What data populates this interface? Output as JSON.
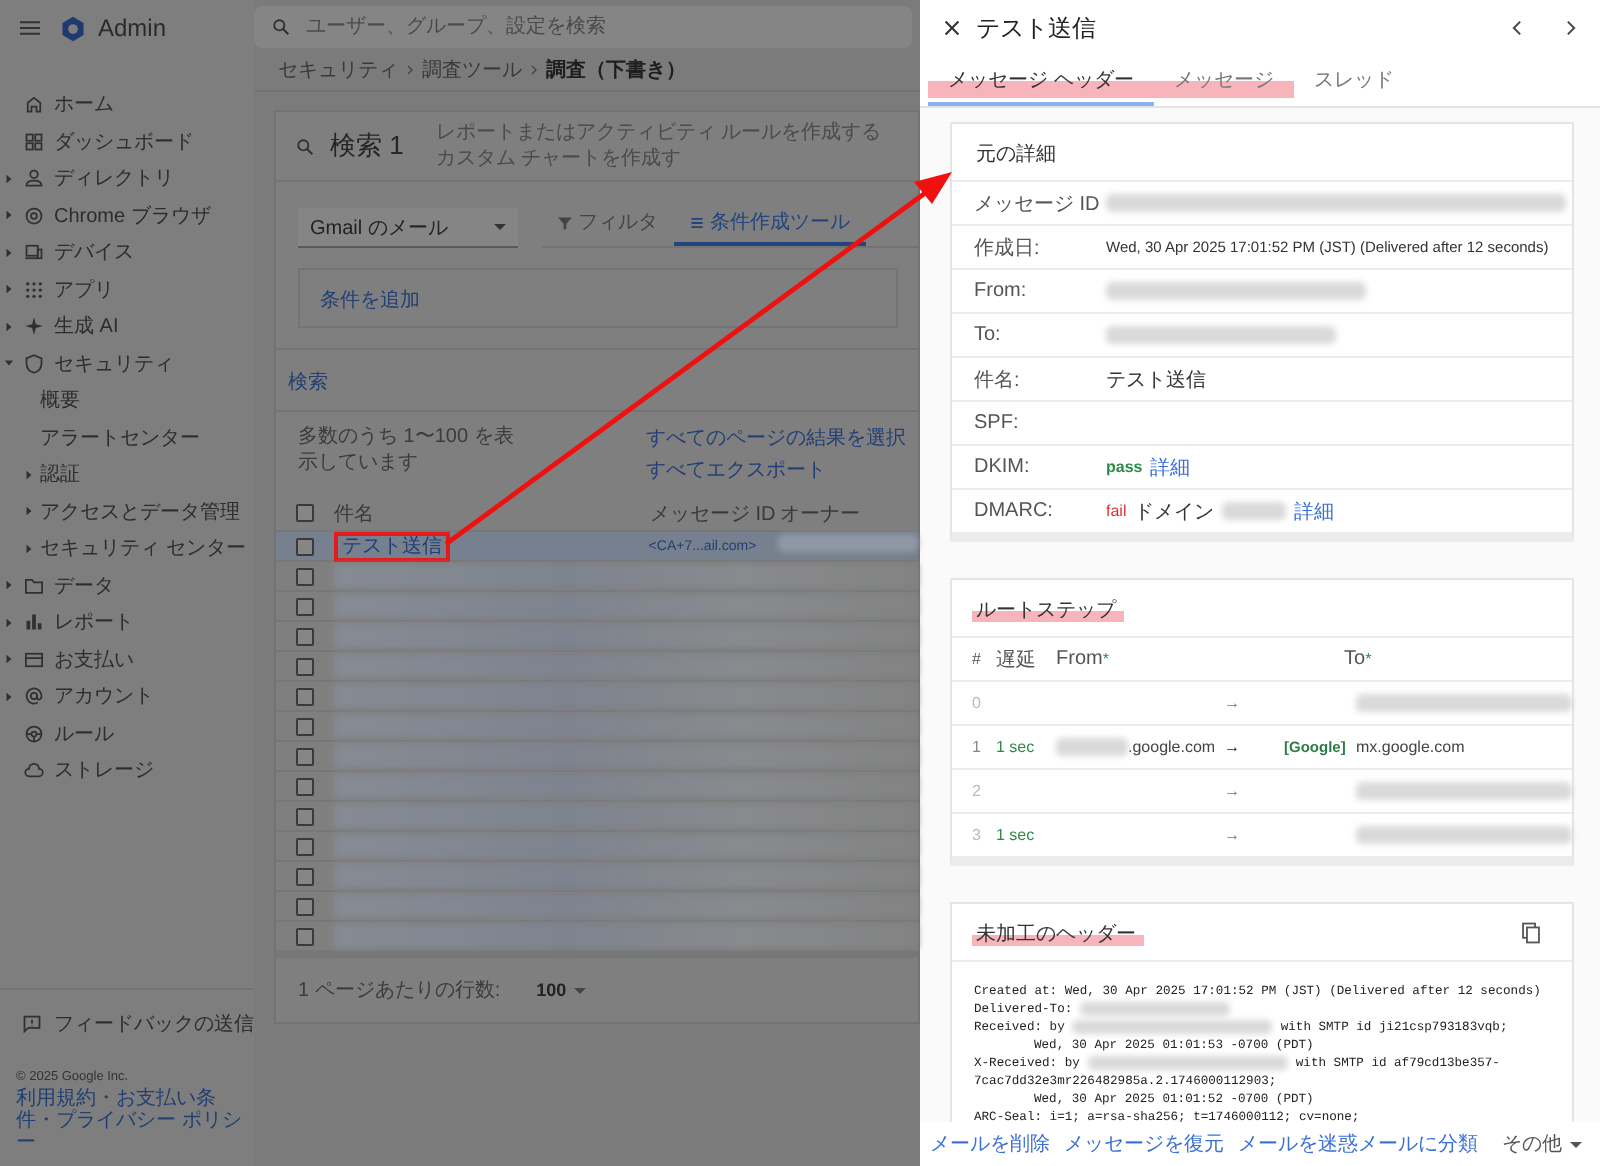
{
  "app": {
    "title": "Admin",
    "search_placeholder": "ユーザー、グループ、設定を検索"
  },
  "breadcrumb": [
    "セキュリティ",
    "調査ツール",
    "調査（下書き）"
  ],
  "sidebar": {
    "items": [
      {
        "label": "ホーム"
      },
      {
        "label": "ダッシュボード"
      },
      {
        "label": "ディレクトリ",
        "expanded": false
      },
      {
        "label": "Chrome ブラウザ",
        "expanded": false
      },
      {
        "label": "デバイス",
        "expanded": false
      },
      {
        "label": "アプリ",
        "expanded": false
      },
      {
        "label": "生成 AI",
        "expanded": false
      },
      {
        "label": "セキュリティ",
        "expanded": true,
        "children": [
          {
            "label": "概要"
          },
          {
            "label": "アラートセンター"
          },
          {
            "label": "認証",
            "expanded": false
          },
          {
            "label": "アクセスとデータ管理",
            "expanded": false
          },
          {
            "label": "セキュリティ センター",
            "expanded": false
          }
        ]
      },
      {
        "label": "データ",
        "expanded": false
      },
      {
        "label": "レポート",
        "expanded": false
      },
      {
        "label": "お支払い",
        "expanded": false
      },
      {
        "label": "アカウント",
        "expanded": false
      },
      {
        "label": "ルール"
      },
      {
        "label": "ストレージ"
      }
    ],
    "feedback": "フィードバックの送信",
    "copyright": "© 2025 Google Inc.",
    "legal_links": "利用規約・お支払い条件・プライバシー ポリシー"
  },
  "investigation": {
    "title": "検索 1",
    "header_links": [
      "レポートまたはアクティビティ ルールを作成する",
      "カスタム チャートを作成す"
    ],
    "source": "Gmail のメール",
    "modes": [
      {
        "label": "フィルタ",
        "selected": false
      },
      {
        "label": "条件作成ツール",
        "selected": true
      }
    ],
    "add_condition": "条件を追加",
    "search_button": "検索",
    "summary": "多数のうち 1〜100 を表示しています",
    "actions": [
      "すべてのページの結果を選択",
      "すべてエクスポート"
    ],
    "columns": [
      "件名",
      "メッセージ ID",
      "オーナー"
    ],
    "header_checked": false,
    "rows": [
      {
        "kind": "message",
        "subject": "テスト送信",
        "message_id": "<CA+7...ail.com>",
        "owner_redacted": true,
        "checked": false,
        "selected": true,
        "boxed": true
      },
      {
        "kind": "redacted",
        "checked": false,
        "selected": false
      },
      {
        "kind": "redacted",
        "checked": false,
        "selected": false
      },
      {
        "kind": "redacted",
        "checked": false,
        "selected": false
      },
      {
        "kind": "redacted",
        "checked": false,
        "selected": false
      },
      {
        "kind": "redacted",
        "checked": false,
        "selected": false
      },
      {
        "kind": "redacted",
        "checked": false,
        "selected": false
      },
      {
        "kind": "redacted",
        "checked": false,
        "selected": false
      },
      {
        "kind": "redacted",
        "checked": false,
        "selected": false
      },
      {
        "kind": "redacted",
        "checked": false,
        "selected": false
      },
      {
        "kind": "redacted",
        "checked": false,
        "selected": false
      },
      {
        "kind": "redacted",
        "checked": false,
        "selected": false
      },
      {
        "kind": "redacted",
        "checked": false,
        "selected": false
      },
      {
        "kind": "redacted",
        "checked": false,
        "selected": false
      }
    ],
    "rows_per_page_label": "1 ページあたりの行数:",
    "rows_per_page": "100"
  },
  "detail": {
    "title": "テスト送信",
    "tabs": [
      {
        "label": "メッセージ ヘッダー",
        "selected": true,
        "marked": true
      },
      {
        "label": "メッセージ",
        "selected": false,
        "marked": true
      },
      {
        "label": "スレッド",
        "selected": false,
        "marked": false
      }
    ],
    "original": {
      "title": "元の詳細",
      "marked": false,
      "rows": [
        {
          "label": "メッセージ ID",
          "kind": "redacted"
        },
        {
          "label": "作成日:",
          "kind": "text",
          "value": "Wed, 30 Apr 2025 17:01:52 PM (JST) (Delivered after 12 seconds)"
        },
        {
          "label": "From:",
          "kind": "redacted"
        },
        {
          "label": "To:",
          "kind": "redacted"
        },
        {
          "label": "件名:",
          "kind": "text",
          "value": "テスト送信"
        },
        {
          "label": "SPF:",
          "kind": "empty"
        },
        {
          "label": "DKIM:",
          "kind": "auth",
          "result": "pass",
          "passed": true,
          "link": "詳細"
        },
        {
          "label": "DMARC:",
          "kind": "auth",
          "result": "fail",
          "passed": false,
          "note": "ドメイン",
          "redacted": true,
          "link": "詳細"
        }
      ]
    },
    "route": {
      "title": "ルートステップ",
      "marked": true,
      "columns": [
        {
          "label": "#"
        },
        {
          "label": "遅延"
        },
        {
          "label": "From",
          "mark": "*"
        },
        {
          "label": "To",
          "mark": "*"
        }
      ],
      "rows": [
        {
          "index": "0",
          "arrow": "→",
          "to_redacted": true
        },
        {
          "index": "1",
          "delay": "1 sec",
          "from_redacted": true,
          "from": ".google.com",
          "arrow": "→",
          "tag": "[Google]",
          "to": "mx.google.com"
        },
        {
          "index": "2",
          "arrow": "→",
          "to_redacted": true
        },
        {
          "index": "3",
          "delay": "1 sec",
          "arrow": "→",
          "to_redacted": true
        }
      ]
    },
    "raw": {
      "title": "未加工のヘッダー",
      "marked": true,
      "lines": [
        {
          "text": "Created at: Wed, 30 Apr 2025 17:01:52 PM (JST) (Delivered after 12 seconds)"
        },
        {
          "text": "Delivered-To:",
          "redacted": true
        },
        {
          "text": "Received: by",
          "redacted": true,
          "after": "with SMTP id ji21csp793183vqb;"
        },
        {
          "text": "Wed, 30 Apr 2025 01:01:53 -0700 (PDT)",
          "indented": true
        },
        {
          "text": "X-Received: by",
          "redacted": true,
          "after": "with SMTP id af79cd13be357-"
        },
        {
          "text": "7cac7dd32e3mr226482985a.2.1746000112903;"
        },
        {
          "text": "Wed, 30 Apr 2025 01:01:52 -0700 (PDT)",
          "indented": true
        },
        {
          "text": "ARC-Seal: i=1; a=rsa-sha256; t=1746000112; cv=none;"
        }
      ]
    },
    "actions": [
      "メールを削除",
      "メッセージを復元",
      "メールを迷惑メールに分類"
    ],
    "more": "その他"
  }
}
